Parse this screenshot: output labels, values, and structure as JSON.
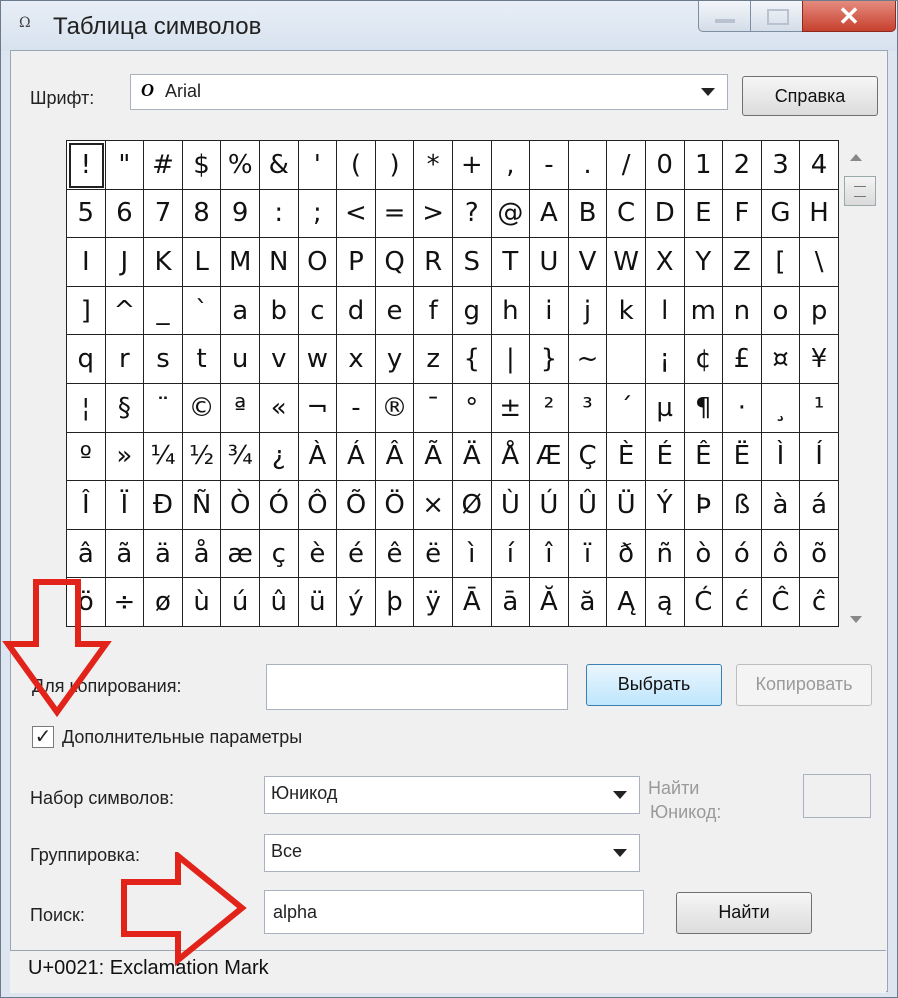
{
  "window": {
    "title": "Таблица символов",
    "close_glyph": "✕"
  },
  "font": {
    "label": "Шрифт:",
    "icon": "O",
    "value": "Arial",
    "help_button": "Справка"
  },
  "grid": {
    "selected_index": 0,
    "rows": [
      [
        "!",
        "\"",
        "#",
        "$",
        "%",
        "&",
        "'",
        "(",
        ")",
        "*",
        "+",
        ",",
        "-",
        ".",
        "/",
        "0",
        "1",
        "2",
        "3",
        "4"
      ],
      [
        "5",
        "6",
        "7",
        "8",
        "9",
        ":",
        ";",
        "<",
        "=",
        ">",
        "?",
        "@",
        "A",
        "B",
        "C",
        "D",
        "E",
        "F",
        "G",
        "H"
      ],
      [
        "I",
        "J",
        "K",
        "L",
        "M",
        "N",
        "O",
        "P",
        "Q",
        "R",
        "S",
        "T",
        "U",
        "V",
        "W",
        "X",
        "Y",
        "Z",
        "[",
        "\\"
      ],
      [
        "]",
        "^",
        "_",
        "`",
        "a",
        "b",
        "c",
        "d",
        "e",
        "f",
        "g",
        "h",
        "i",
        "j",
        "k",
        "l",
        "m",
        "n",
        "o",
        "p"
      ],
      [
        "q",
        "r",
        "s",
        "t",
        "u",
        "v",
        "w",
        "x",
        "y",
        "z",
        "{",
        "|",
        "}",
        "~",
        " ",
        "¡",
        "¢",
        "£",
        "¤",
        "¥"
      ],
      [
        "¦",
        "§",
        "¨",
        "©",
        "ª",
        "«",
        "¬",
        "-",
        "®",
        "¯",
        "°",
        "±",
        "²",
        "³",
        "´",
        "µ",
        "¶",
        "·",
        "¸",
        "¹"
      ],
      [
        "º",
        "»",
        "¼",
        "½",
        "¾",
        "¿",
        "À",
        "Á",
        "Â",
        "Ã",
        "Ä",
        "Å",
        "Æ",
        "Ç",
        "È",
        "É",
        "Ê",
        "Ë",
        "Ì",
        "Í"
      ],
      [
        "Î",
        "Ï",
        "Ð",
        "Ñ",
        "Ò",
        "Ó",
        "Ô",
        "Õ",
        "Ö",
        "×",
        "Ø",
        "Ù",
        "Ú",
        "Û",
        "Ü",
        "Ý",
        "Þ",
        "ß",
        "à",
        "á"
      ],
      [
        "â",
        "ã",
        "ä",
        "å",
        "æ",
        "ç",
        "è",
        "é",
        "ê",
        "ë",
        "ì",
        "í",
        "î",
        "ï",
        "ð",
        "ñ",
        "ò",
        "ó",
        "ô",
        "õ"
      ],
      [
        "ö",
        "÷",
        "ø",
        "ù",
        "ú",
        "û",
        "ü",
        "ý",
        "þ",
        "ÿ",
        "Ā",
        "ā",
        "Ă",
        "ă",
        "Ą",
        "ą",
        "Ć",
        "ć",
        "Ĉ",
        "ĉ"
      ]
    ]
  },
  "copy": {
    "label": "Для копирования:",
    "value": "",
    "select_button": "Выбрать",
    "copy_button": "Копировать"
  },
  "advanced": {
    "checkbox_label": "Дополнительные параметры",
    "checked": true,
    "check_glyph": "✓"
  },
  "charset": {
    "label": "Набор символов:",
    "value": "Юникод",
    "goto_label_line1": "Найти",
    "goto_label_line2": "Юникод:",
    "goto_value": ""
  },
  "grouping": {
    "label": "Группировка:",
    "value": "Все"
  },
  "search": {
    "label": "Поиск:",
    "value": "alpha",
    "button": "Найти"
  },
  "status": {
    "text": "U+0021: Exclamation Mark"
  },
  "colors": {
    "annotation_arrow": "#e2231a",
    "primary_button": "#bee6fd"
  }
}
